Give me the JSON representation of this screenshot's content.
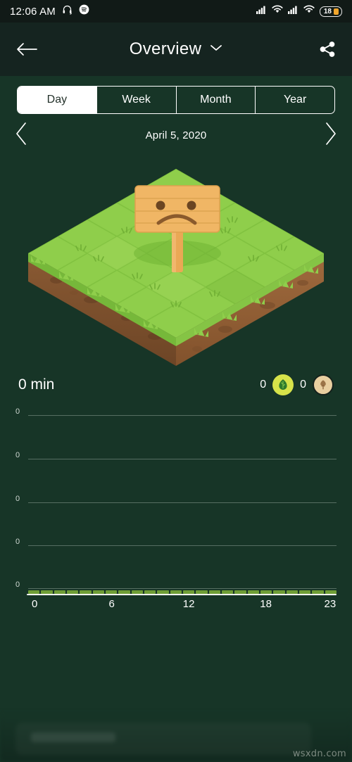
{
  "status_bar": {
    "time": "12:06 AM",
    "icons_left": [
      "headphones-icon",
      "spotify-icon"
    ],
    "icons_right": [
      "signal-bars-icon",
      "wifi-icon",
      "signal-bars-icon",
      "wifi-icon"
    ],
    "battery_level": "18"
  },
  "app_bar": {
    "back_icon": "arrow-left-icon",
    "title": "Overview",
    "dropdown_icon": "chevron-down-icon",
    "share_icon": "share-icon"
  },
  "period_tabs": {
    "items": [
      {
        "label": "Day",
        "selected": true
      },
      {
        "label": "Week",
        "selected": false
      },
      {
        "label": "Month",
        "selected": false
      },
      {
        "label": "Year",
        "selected": false
      }
    ]
  },
  "date_nav": {
    "prev_icon": "chevron-left-icon",
    "date": "April 5, 2020",
    "next_icon": "chevron-right-icon"
  },
  "illustration": {
    "name": "empty-forest-plot",
    "sign_face": "sad-face",
    "grass_color": "#8fce4b",
    "grass_top_color": "#a5d95c",
    "dirt_color": "#8a5a33",
    "sign_color": "#f0b665"
  },
  "summary": {
    "total_time": "0 min",
    "leaf_count": "0",
    "leaf_icon": "leaf-badge-icon",
    "tree_count": "0",
    "tree_icon": "tree-badge-icon"
  },
  "chart_data": {
    "type": "bar",
    "title": "",
    "xlabel": "",
    "ylabel": "",
    "categories": [
      "0",
      "1",
      "2",
      "3",
      "4",
      "5",
      "6",
      "7",
      "8",
      "9",
      "10",
      "11",
      "12",
      "13",
      "14",
      "15",
      "16",
      "17",
      "18",
      "19",
      "20",
      "21",
      "22",
      "23"
    ],
    "values": [
      0,
      0,
      0,
      0,
      0,
      0,
      0,
      0,
      0,
      0,
      0,
      0,
      0,
      0,
      0,
      0,
      0,
      0,
      0,
      0,
      0,
      0,
      0,
      0
    ],
    "ytick_labels": [
      "0",
      "0",
      "0",
      "0",
      "0"
    ],
    "xtick_labels": [
      "0",
      "6",
      "12",
      "18",
      "23"
    ],
    "xtick_positions": [
      0,
      6,
      12,
      18,
      23
    ],
    "ylim": [
      0,
      0
    ],
    "grid": true,
    "legend": "none",
    "bar_color": "#6f9e36",
    "axis_color": "#ffffff"
  },
  "bottom_section": {
    "watermark": "wsxdn.com"
  }
}
